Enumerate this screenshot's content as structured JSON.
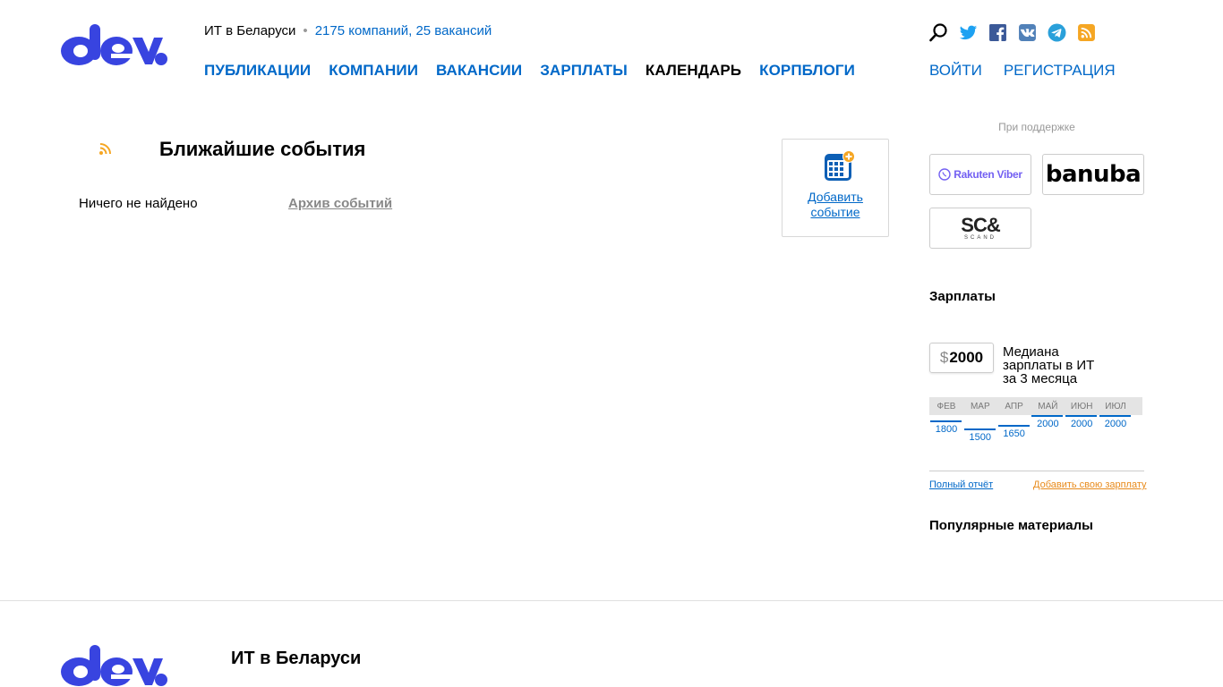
{
  "header": {
    "tagline": "ИТ в Беларуси",
    "stats": "2175 компаний, 25 вакансий",
    "nav": [
      {
        "label": "ПУБЛИКАЦИИ"
      },
      {
        "label": "КОМПАНИИ"
      },
      {
        "label": "ВАКАНСИИ"
      },
      {
        "label": "ЗАРПЛАТЫ"
      },
      {
        "label": "КАЛЕНДАРЬ",
        "active": true
      },
      {
        "label": "КОРПБЛОГИ"
      }
    ],
    "login": "ВОЙТИ",
    "register": "РЕГИСТРАЦИЯ",
    "social_icons": [
      "search-icon",
      "twitter-icon",
      "facebook-icon",
      "vk-icon",
      "telegram-icon",
      "rss-icon"
    ]
  },
  "events": {
    "title": "Ближайшие события",
    "empty": "Ничего не найдено",
    "archive": "Архив событий",
    "add_event": "Добавить событие"
  },
  "sidebar": {
    "support_label": "При поддержке",
    "sponsors": [
      "Rakuten Viber",
      "banuba",
      "SC&"
    ],
    "sponsor_subtext": "SCAND",
    "salaries_title": "Зарплаты",
    "currency": "$",
    "median_value": "2000",
    "median_desc": "Медиана зарплаты в ИТ за 3 месяца",
    "months": [
      {
        "label": "ФЕВ",
        "value": 1800
      },
      {
        "label": "МАР",
        "value": 1500
      },
      {
        "label": "АПР",
        "value": 1650
      },
      {
        "label": "МАЙ",
        "value": 2000
      },
      {
        "label": "ИЮН",
        "value": 2000
      },
      {
        "label": "ИЮЛ",
        "value": 2000
      }
    ],
    "full_report": "Полный отчёт",
    "add_salary": "Добавить свою зарплату",
    "popular_title": "Популярные материалы"
  },
  "footer": {
    "title": "ИТ в Беларуси"
  },
  "colors": {
    "brand": "#3844e0",
    "link": "#0068c8",
    "rss": "#f5a623",
    "accent_orange": "#e88a1a"
  }
}
